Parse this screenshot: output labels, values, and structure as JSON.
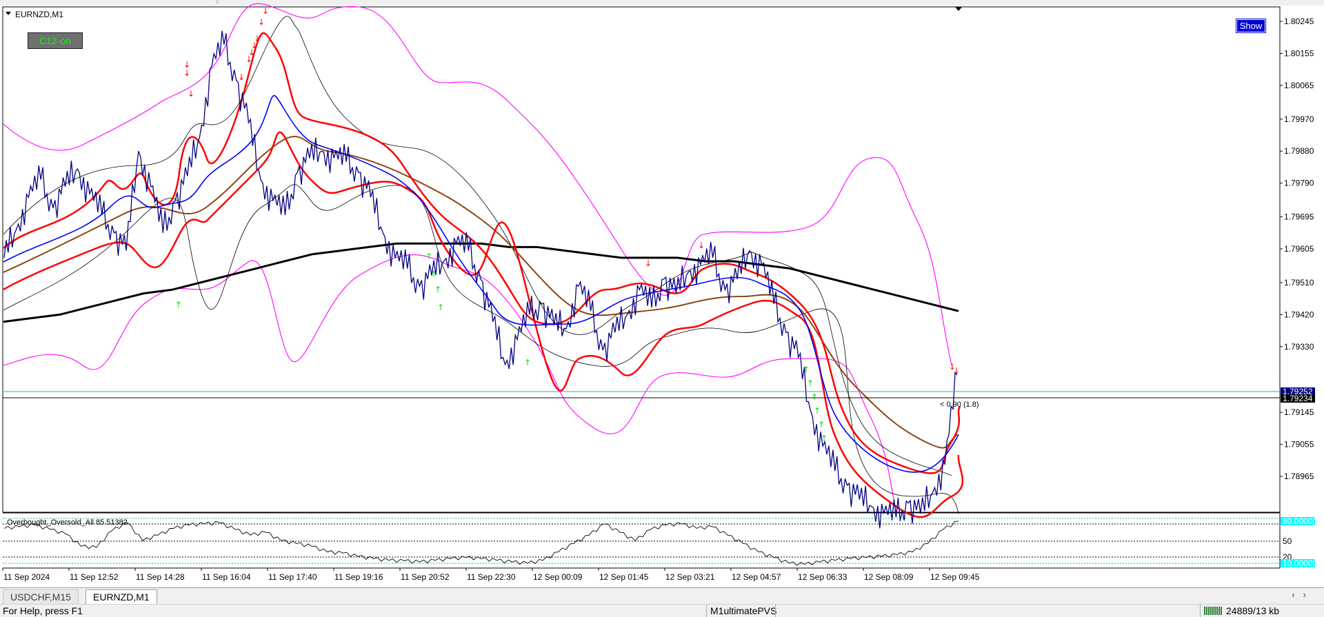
{
  "symbol_title": "EURNZD,M1",
  "indicator_button": "C12-on",
  "show_button": "Show",
  "price_axis": [
    "1.80245",
    "1.80155",
    "1.80065",
    "1.79970",
    "1.79880",
    "1.79790",
    "1.79695",
    "1.79605",
    "1.79510",
    "1.79420",
    "1.79330",
    "1.79145",
    "1.79055",
    "1.78965"
  ],
  "price_tags": {
    "ask": "1.79252",
    "bid": "1.79234"
  },
  "spread_label": "< 0.90 (1.8)",
  "oscillator": {
    "title": "Overbought_Oversold_All 85.51382",
    "levels": [
      "80.00000",
      "50",
      "20",
      "10.00000"
    ]
  },
  "time_axis": [
    "11 Sep 2024",
    "11 Sep 12:52",
    "11 Sep 14:28",
    "11 Sep 16:04",
    "11 Sep 17:40",
    "11 Sep 19:16",
    "11 Sep 20:52",
    "11 Sep 22:30",
    "12 Sep 00:09",
    "12 Sep 01:45",
    "12 Sep 03:21",
    "12 Sep 04:57",
    "12 Sep 06:33",
    "12 Sep 08:09",
    "12 Sep 09:45"
  ],
  "tabs": [
    "USDCHF,M15",
    "EURNZD,M1"
  ],
  "active_tab": "EURNZD,M1",
  "status": {
    "help": "For Help, press F1",
    "profile": "M1ultimatePVS",
    "traffic": "24889/13 kb"
  },
  "colors": {
    "bollinger_outer": "#ff00ff",
    "envelope": "#ff0000",
    "ma_long": "#000000",
    "ma_mid": "#8b4513",
    "ma_fast": "#0000ff",
    "price": "#000080",
    "ask_line": "#20b2aa",
    "tag_bg": "#00008b",
    "level_bg": "#00ffff"
  },
  "price_series": [
    1.7958,
    1.7966,
    1.7975,
    1.798,
    1.7972,
    1.7978,
    1.7983,
    1.7976,
    1.797,
    1.7965,
    1.796,
    1.7988,
    1.7978,
    1.7965,
    1.7974,
    1.7981,
    1.7992,
    1.8012,
    1.8018,
    1.8008,
    1.7996,
    1.798,
    1.7974,
    1.797,
    1.7982,
    1.7986,
    1.7988,
    1.7986,
    1.7985,
    1.7982,
    1.7975,
    1.7965,
    1.7958,
    1.7955,
    1.795,
    1.7953,
    1.7957,
    1.7962,
    1.796,
    1.7952,
    1.794,
    1.7928,
    1.7935,
    1.7942,
    1.7945,
    1.7939,
    1.7938,
    1.795,
    1.7943,
    1.7932,
    1.7937,
    1.7942,
    1.7949,
    1.7944,
    1.7952,
    1.7948,
    1.7954,
    1.7956,
    1.7958,
    1.7949,
    1.7952,
    1.796,
    1.7956,
    1.7945,
    1.7937,
    1.793,
    1.7915,
    1.7905,
    1.7898,
    1.7894,
    1.789,
    1.7888,
    1.7886,
    1.7885,
    1.7889,
    1.7886,
    1.7892,
    1.79,
    1.7925
  ],
  "long_ma_series": [
    1.794,
    1.7941,
    1.7942,
    1.7944,
    1.7946,
    1.7948,
    1.7949,
    1.7951,
    1.7953,
    1.7955,
    1.7957,
    1.7959,
    1.796,
    1.7961,
    1.7962,
    1.7962,
    1.7962,
    1.7962,
    1.7961,
    1.7961,
    1.796,
    1.7959,
    1.7958,
    1.7958,
    1.7958,
    1.7957,
    1.7957,
    1.7956,
    1.7955,
    1.7953,
    1.7951,
    1.7949,
    1.7947,
    1.7945,
    1.7943
  ],
  "oscillator_series": [
    72,
    75,
    78,
    70,
    62,
    40,
    38,
    68,
    82,
    50,
    60,
    72,
    78,
    80,
    82,
    70,
    60,
    65,
    50,
    45,
    40,
    30,
    28,
    22,
    18,
    15,
    14,
    12,
    15,
    18,
    20,
    18,
    15,
    12,
    10,
    15,
    30,
    45,
    60,
    80,
    65,
    50,
    70,
    78,
    80,
    72,
    75,
    60,
    45,
    30,
    20,
    10,
    8,
    12,
    15,
    18,
    20,
    22,
    25,
    30,
    45,
    70,
    85
  ]
}
